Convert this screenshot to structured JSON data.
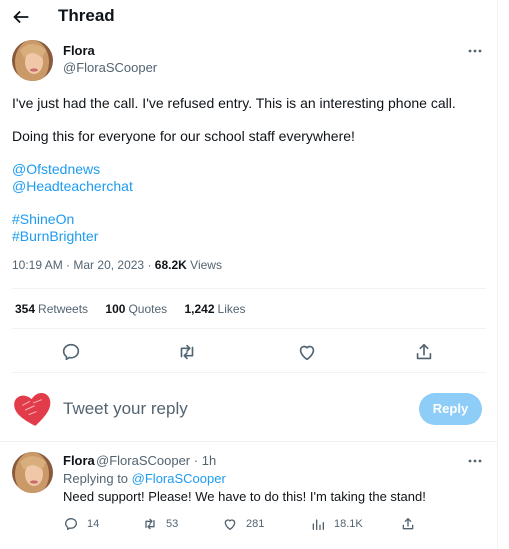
{
  "colors": {
    "accent": "#1d9bf0",
    "muted": "#536471",
    "text": "#0f1419",
    "reply_button_bg": "#8ecdf8"
  },
  "header": {
    "title": "Thread",
    "back_icon": "arrow-left-icon"
  },
  "tweet": {
    "author_name": "Flora",
    "author_handle": "@FloraSCooper",
    "text_line1": "I've just had the call.  I've refused entry.  This is an interesting phone call.",
    "text_line2": "Doing this for everyone for our school staff everywhere!",
    "mention1": "@Ofstednews",
    "mention2": "@Headteacherchat",
    "hashtag1": "#ShineOn",
    "hashtag2": "#BurnBrighter",
    "time": "10:19 AM",
    "date": "Mar 20, 2023",
    "separator": "·",
    "views_count": "68.2K",
    "views_label": "Views",
    "retweets_count": "354",
    "retweets_label": "Retweets",
    "quotes_count": "100",
    "quotes_label": "Quotes",
    "likes_count": "1,242",
    "likes_label": "Likes"
  },
  "reply_box": {
    "placeholder": "Tweet your reply",
    "button_label": "Reply"
  },
  "reply_tweet": {
    "author_name": "Flora",
    "author_handle": "@FloraSCooper",
    "separator": "·",
    "time_ago": "1h",
    "replying_to_label": "Replying to",
    "replying_to_handle": "@FloraSCooper",
    "text": "Need support!  Please!  We have to do this!  I'm taking the stand!",
    "replies": "14",
    "retweets": "53",
    "likes": "281",
    "views": "18.1K"
  }
}
